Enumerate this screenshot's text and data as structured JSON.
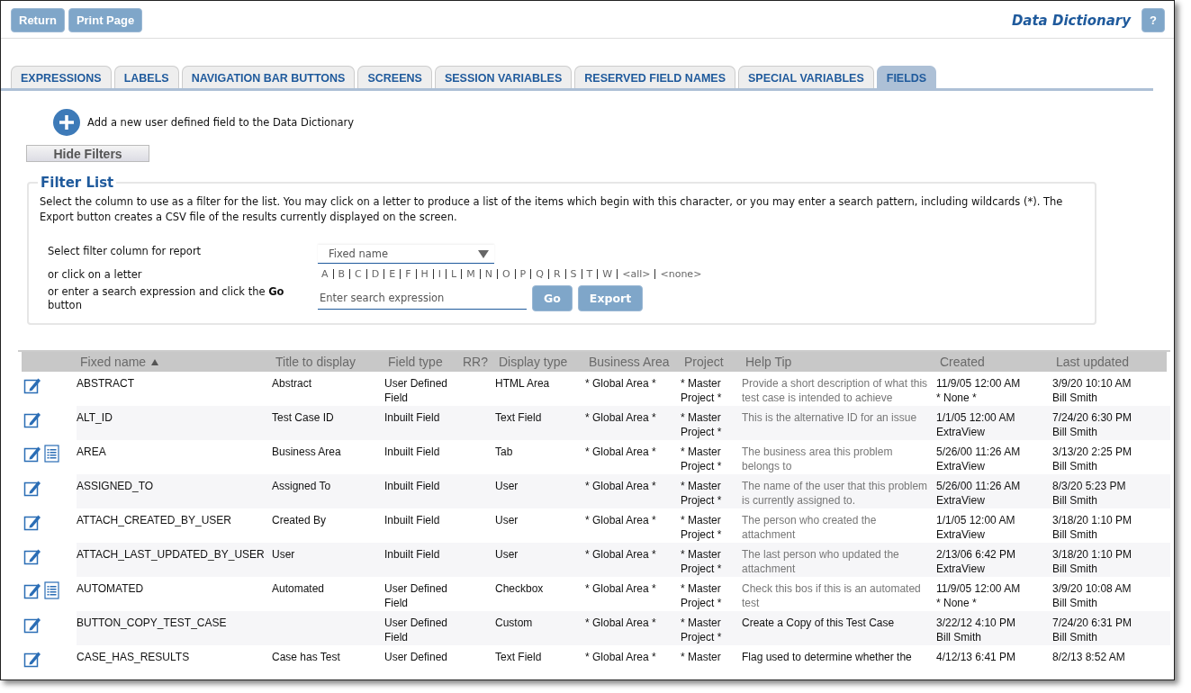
{
  "toolbar": {
    "buttons": [
      "Return",
      "Print Page"
    ],
    "title": "Data Dictionary",
    "help_button": "?"
  },
  "tabs": [
    {
      "label": "EXPRESSIONS",
      "selected": false
    },
    {
      "label": "LABELS",
      "selected": false
    },
    {
      "label": "NAVIGATION BAR BUTTONS",
      "selected": false
    },
    {
      "label": "SCREENS",
      "selected": false
    },
    {
      "label": "SESSION VARIABLES",
      "selected": false
    },
    {
      "label": "RESERVED FIELD NAMES",
      "selected": false
    },
    {
      "label": "SPECIAL VARIABLES",
      "selected": false
    },
    {
      "label": "FIELDS",
      "selected": true
    }
  ],
  "add_link": "Add a new user defined field to the Data Dictionary",
  "hide_filters_button": "Hide Filters",
  "filter": {
    "legend": "Filter List",
    "description": "Select the column to use as a filter for the list. You may click on a letter to produce a list of the items which begin with this character, or you may enter a search pattern, including wildcards (*). The Export button creates a CSV file of the results currently displayed on the screen.",
    "column_label": "Select filter column for report",
    "column_value": "Fixed name",
    "letter_label": "or click on a letter",
    "letters": [
      "A",
      "B",
      "C",
      "D",
      "E",
      "F",
      "H",
      "I",
      "L",
      "M",
      "N",
      "O",
      "P",
      "Q",
      "R",
      "S",
      "T",
      "W",
      "<all>",
      "<none>"
    ],
    "search_label": "or enter a search expression and click the **Go** button",
    "search_placeholder": "Enter search expression",
    "buttons": [
      "Go",
      "Export"
    ]
  },
  "table": {
    "columns": [
      {
        "label": "Fixed name",
        "sorted": true
      },
      {
        "label": "Title to display",
        "sorted": false
      },
      {
        "label": "Field type",
        "sorted": false
      },
      {
        "label": "RR?",
        "sorted": false
      },
      {
        "label": "Display type",
        "sorted": false
      },
      {
        "label": "Business Area",
        "sorted": false
      },
      {
        "label": "Project",
        "sorted": false
      },
      {
        "label": "Help Tip",
        "sorted": false
      },
      {
        "label": "Created",
        "sorted": false
      },
      {
        "label": "Last updated",
        "sorted": false
      }
    ],
    "rows": [
      {
        "has_list": false,
        "fixed_name": "ABSTRACT",
        "title": "Abstract",
        "field_type": "User Defined Field",
        "display_type": "HTML Area",
        "business_area": "* Global Area *",
        "project": "* Master Project *",
        "help_tip": "Provide a short description of what this test case is intended to achieve",
        "help_tip_muted": true,
        "created": "11/9/05 12:00 AM\n* None *",
        "last_updated": "3/9/20 10:10 AM\nBill Smith"
      },
      {
        "has_list": false,
        "fixed_name": "ALT_ID",
        "title": "Test Case ID",
        "field_type": "Inbuilt Field",
        "display_type": "Text Field",
        "business_area": "* Global Area *",
        "project": "* Master Project *",
        "help_tip": "This is the alternative ID for an issue",
        "help_tip_muted": true,
        "created": "1/1/05 12:00 AM\nExtraView",
        "last_updated": "7/24/20 6:30 PM\nBill Smith"
      },
      {
        "has_list": true,
        "fixed_name": "AREA",
        "title": "Business Area",
        "field_type": "Inbuilt Field",
        "display_type": "Tab",
        "business_area": "* Global Area *",
        "project": "* Master Project *",
        "help_tip": "The business area this problem belongs to",
        "help_tip_muted": true,
        "created": "5/26/00 11:26 AM\nExtraView",
        "last_updated": "3/13/20 2:25 PM\nBill Smith"
      },
      {
        "has_list": false,
        "fixed_name": "ASSIGNED_TO",
        "title": "Assigned To",
        "field_type": "Inbuilt Field",
        "display_type": "User",
        "business_area": "* Global Area *",
        "project": "* Master Project *",
        "help_tip": "The name of the user that this problem is currently assigned to.",
        "help_tip_muted": true,
        "created": "5/26/00 11:26 AM\nExtraView",
        "last_updated": "8/3/20 5:23 PM\nBill Smith"
      },
      {
        "has_list": false,
        "fixed_name": "ATTACH_CREATED_BY_USER",
        "title": "Created By",
        "field_type": "Inbuilt Field",
        "display_type": "User",
        "business_area": "* Global Area *",
        "project": "* Master Project *",
        "help_tip": "The person who created the attachment",
        "help_tip_muted": true,
        "created": "1/1/05 12:00 AM\nExtraView",
        "last_updated": "3/18/20 1:10 PM\nBill Smith"
      },
      {
        "has_list": false,
        "fixed_name": "ATTACH_LAST_UPDATED_BY_USER",
        "title": "User",
        "field_type": "Inbuilt Field",
        "display_type": "User",
        "business_area": "* Global Area *",
        "project": "* Master Project *",
        "help_tip": "The last person who updated the attachment",
        "help_tip_muted": true,
        "created": "2/13/06 6:42 PM\nExtraView",
        "last_updated": "3/18/20 1:10 PM\nBill Smith"
      },
      {
        "has_list": true,
        "fixed_name": "AUTOMATED",
        "title": "Automated",
        "field_type": "User Defined Field",
        "display_type": "Checkbox",
        "business_area": "* Global Area *",
        "project": "* Master Project *",
        "help_tip": "Check this bos if this is an automated test",
        "help_tip_muted": true,
        "created": "11/9/05 12:00 AM\n* None *",
        "last_updated": "3/9/20 10:08 AM\nBill Smith"
      },
      {
        "has_list": false,
        "fixed_name": "BUTTON_COPY_TEST_CASE",
        "title": "",
        "field_type": "User Defined Field",
        "display_type": "Custom",
        "business_area": "* Global Area *",
        "project": "* Master Project *",
        "help_tip": "Create a Copy of this Test Case",
        "help_tip_muted": false,
        "created": "3/22/12 4:10 PM\nBill Smith",
        "last_updated": "7/24/20 6:31 PM\nBill Smith"
      },
      {
        "has_list": false,
        "fixed_name": "CASE_HAS_RESULTS",
        "title": "Case has Test",
        "field_type": "User Defined",
        "display_type": "Text Field",
        "business_area": "* Global Area *",
        "project": "* Master",
        "help_tip": "Flag used to determine whether the",
        "help_tip_muted": false,
        "created": "4/12/13 6:41 PM",
        "last_updated": "8/2/13 8:52 AM"
      }
    ]
  }
}
